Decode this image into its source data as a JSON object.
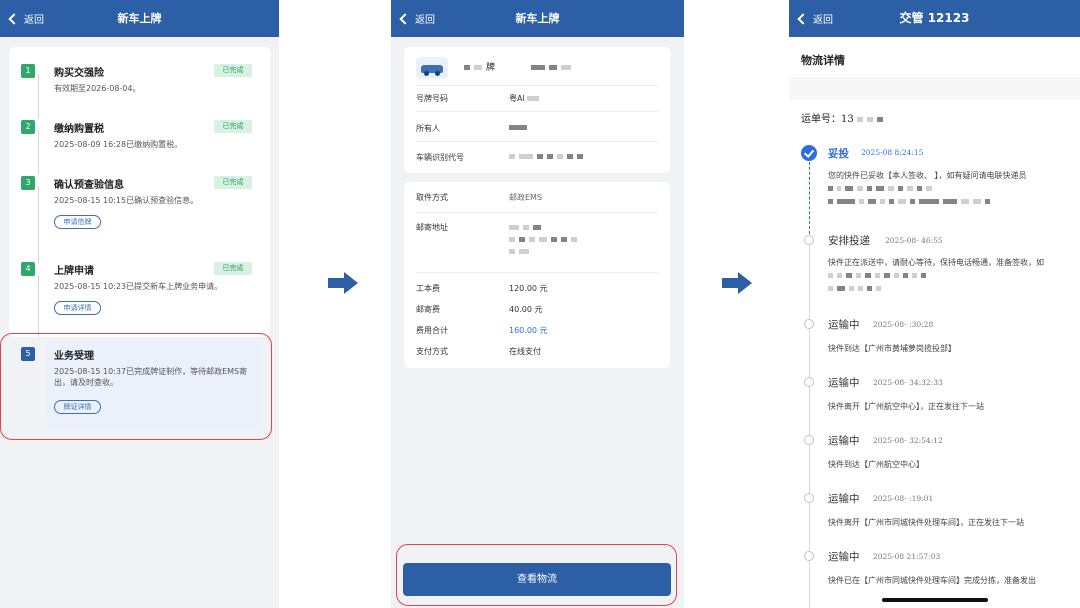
{
  "panel1": {
    "back": "返回",
    "title": "新车上牌",
    "steps": [
      {
        "num": "1",
        "name": "购买交强险",
        "status": "已完成",
        "desc": "有效期至2026-08-04。",
        "pill": ""
      },
      {
        "num": "2",
        "name": "缴纳购置税",
        "status": "已完成",
        "desc": "2025-08-09 16:28已缴纳购置税。",
        "pill": ""
      },
      {
        "num": "3",
        "name": "确认预查验信息",
        "status": "已完成",
        "desc": "2025-08-15 10:15已确认预查验信息。",
        "pill": "申请信牌"
      },
      {
        "num": "4",
        "name": "上牌申请",
        "status": "已完成",
        "desc": "2025-08-15 10:23已提交新车上牌业务申请。",
        "pill": "申请详情"
      },
      {
        "num": "5",
        "name": "业务受理",
        "status": "",
        "desc": "2025-08-15 10:37已完成牌证制作，等待邮政EMS寄出，请及时查收。",
        "pill": "牌证详情"
      }
    ]
  },
  "panel2": {
    "back": "返回",
    "title": "新车上牌",
    "vehicle_header": "牌",
    "plate_label": "号牌号码",
    "plate_value": "粤AI",
    "owner_label": "所有人",
    "vin_label": "车辆识别代号",
    "pickup_label": "取件方式",
    "pickup_value": "邮政EMS",
    "address_label": "邮寄地址",
    "fee1_label": "工本费",
    "fee1_value": "120.00 元",
    "fee2_label": "邮寄费",
    "fee2_value": "40.00 元",
    "total_label": "费用合计",
    "total_value": "160.00 元",
    "pay_label": "支付方式",
    "pay_value": "在线支付",
    "button": "查看物流"
  },
  "panel3": {
    "back": "返回",
    "title": "交管 12123",
    "heading": "物流详情",
    "waybill": "运单号：13",
    "events": [
      {
        "status": "妥投",
        "time": "2025-08   8:24:15",
        "desc": "您的快件已妥收【本人签收、    】，如有疑问请电联快递员"
      },
      {
        "status": "安排投递",
        "time": "2025-08-    46:55",
        "desc": "快件正在派送中，请耐心等待，保持电话畅通，准备签收，如"
      },
      {
        "status": "运输中",
        "time": "2025-08-    :30:28",
        "desc": "快件到达【广州市黄埔萝岗揽投部】"
      },
      {
        "status": "运输中",
        "time": "2025-08-   34:32:33",
        "desc": "快件离开【广州航空中心】，正在发往下一站"
      },
      {
        "status": "运输中",
        "time": "2025-08-   32:54:12",
        "desc": "快件到达【广州航空中心】"
      },
      {
        "status": "运输中",
        "time": "2025-08-    :19:01",
        "desc": "快件离开【广州市同城快件处理车间】，正在发往下一站"
      },
      {
        "status": "运输中",
        "time": "2025-08   21:57:03",
        "desc": "快件已在【广州市同城快件处理车间】完成分拣，准备发出"
      }
    ]
  },
  "colors": {
    "primary": "#2d5fa6",
    "success": "#2aa063",
    "highlight": "#e0454a",
    "active": "#2d6de0"
  }
}
